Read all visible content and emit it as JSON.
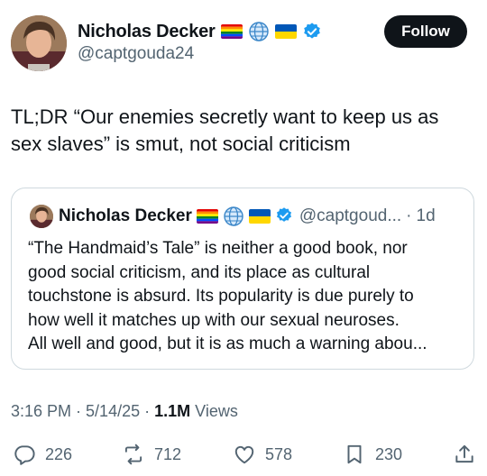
{
  "author": {
    "display_name": "Nicholas Decker",
    "handle": "@captgouda24",
    "badges": [
      "rainbow-flag-icon",
      "globe-icon",
      "ukraine-flag-icon",
      "verified-badge-icon"
    ]
  },
  "follow_label": "Follow",
  "tweet_text": "TL;DR “Our enemies secretly want to keep us as\nsex slaves” is smut, not social criticism",
  "quote": {
    "display_name": "Nicholas Decker",
    "handle": "@captgoud...",
    "separator": "·",
    "time": "1d",
    "text": "“The Handmaid’s Tale” is neither a good book, nor\ngood social criticism, and its place as cultural\ntouchstone is absurd. Its popularity is due purely to\nhow well it matches up with our sexual neuroses.\nAll well and good, but it is as much a warning abou..."
  },
  "meta": {
    "time": "3:16 PM",
    "sep1": "·",
    "date": "5/14/25",
    "sep2": "·",
    "views_count": "1.1M",
    "views_label": "Views"
  },
  "actions": {
    "replies": "226",
    "reposts": "712",
    "likes": "578",
    "bookmarks": "230"
  },
  "colors": {
    "text": "#0f1419",
    "secondary": "#536471",
    "verified": "#1d9bf0",
    "border": "#cfd9de"
  }
}
